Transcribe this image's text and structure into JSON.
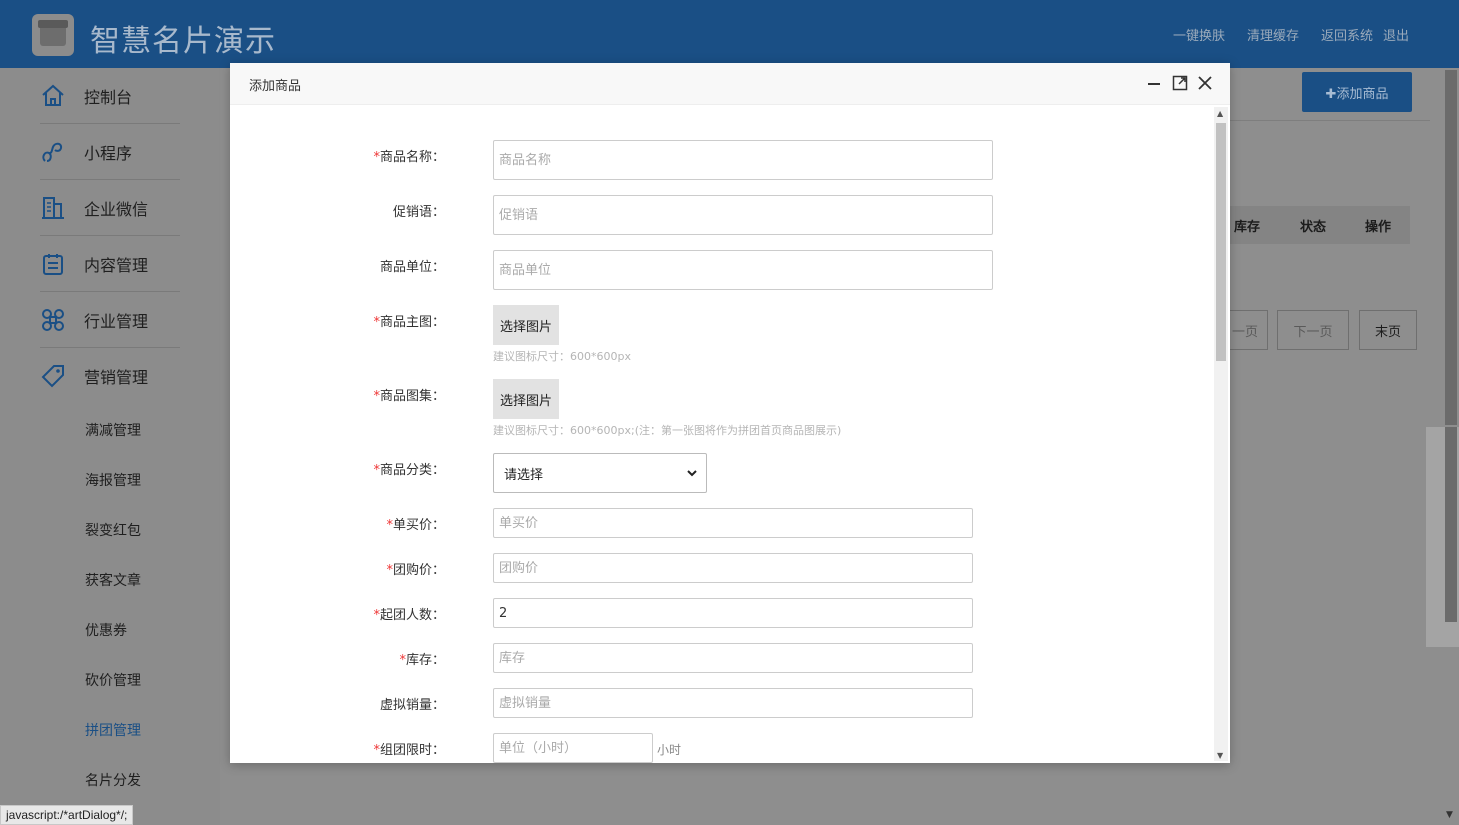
{
  "header": {
    "app_title": "智慧名片演示",
    "links": [
      "一键换肤",
      "清理缓存",
      "返回系统",
      "退出"
    ]
  },
  "sidebar": {
    "items": [
      {
        "label": "控制台",
        "icon": "home-icon"
      },
      {
        "label": "小程序",
        "icon": "miniprogram-icon"
      },
      {
        "label": "企业微信",
        "icon": "building-icon"
      },
      {
        "label": "内容管理",
        "icon": "clipboard-icon"
      },
      {
        "label": "行业管理",
        "icon": "command-icon"
      },
      {
        "label": "营销管理",
        "icon": "tag-icon"
      }
    ],
    "sub_items": [
      "满减管理",
      "海报管理",
      "裂变红包",
      "获客文章",
      "优惠券",
      "砍价管理",
      "拼团管理",
      "名片分发"
    ],
    "active_sub": "拼团管理"
  },
  "background": {
    "add_button": "✚添加商品",
    "table_headers": [
      "库存",
      "状态",
      "操作"
    ],
    "pager": [
      "一页",
      "下一页",
      "末页"
    ]
  },
  "dialog": {
    "title": "添加商品",
    "fields": {
      "name": {
        "label": "商品名称：",
        "placeholder": "商品名称",
        "required": true
      },
      "promo": {
        "label": "促销语：",
        "placeholder": "促销语",
        "required": false
      },
      "unit": {
        "label": "商品单位：",
        "placeholder": "商品单位",
        "required": false
      },
      "main_image": {
        "label": "商品主图：",
        "button": "选择图片",
        "hint": "建议图标尺寸：600*600px",
        "required": true
      },
      "gallery": {
        "label": "商品图集：",
        "button": "选择图片",
        "hint": "建议图标尺寸：600*600px;(注：第一张图将作为拼团首页商品图展示)",
        "required": true
      },
      "category": {
        "label": "商品分类：",
        "selected": "请选择",
        "required": true
      },
      "single_price": {
        "label": "单买价：",
        "placeholder": "单买价",
        "required": true
      },
      "group_price": {
        "label": "团购价：",
        "placeholder": "团购价",
        "required": true
      },
      "min_people": {
        "label": "起团人数：",
        "value": "2",
        "required": true
      },
      "stock": {
        "label": "库存：",
        "placeholder": "库存",
        "required": true
      },
      "virtual_sales": {
        "label": "虚拟销量：",
        "placeholder": "虚拟销量",
        "required": false
      },
      "time_limit": {
        "label": "组团限时：",
        "placeholder": "单位（小时）",
        "unit": "小时",
        "required": true
      }
    }
  },
  "status_bar": "javascript:/*artDialog*/;",
  "colors": {
    "header_bg": "#1a4f85",
    "required": "#e33333",
    "active_nav": "#1a4f85"
  }
}
